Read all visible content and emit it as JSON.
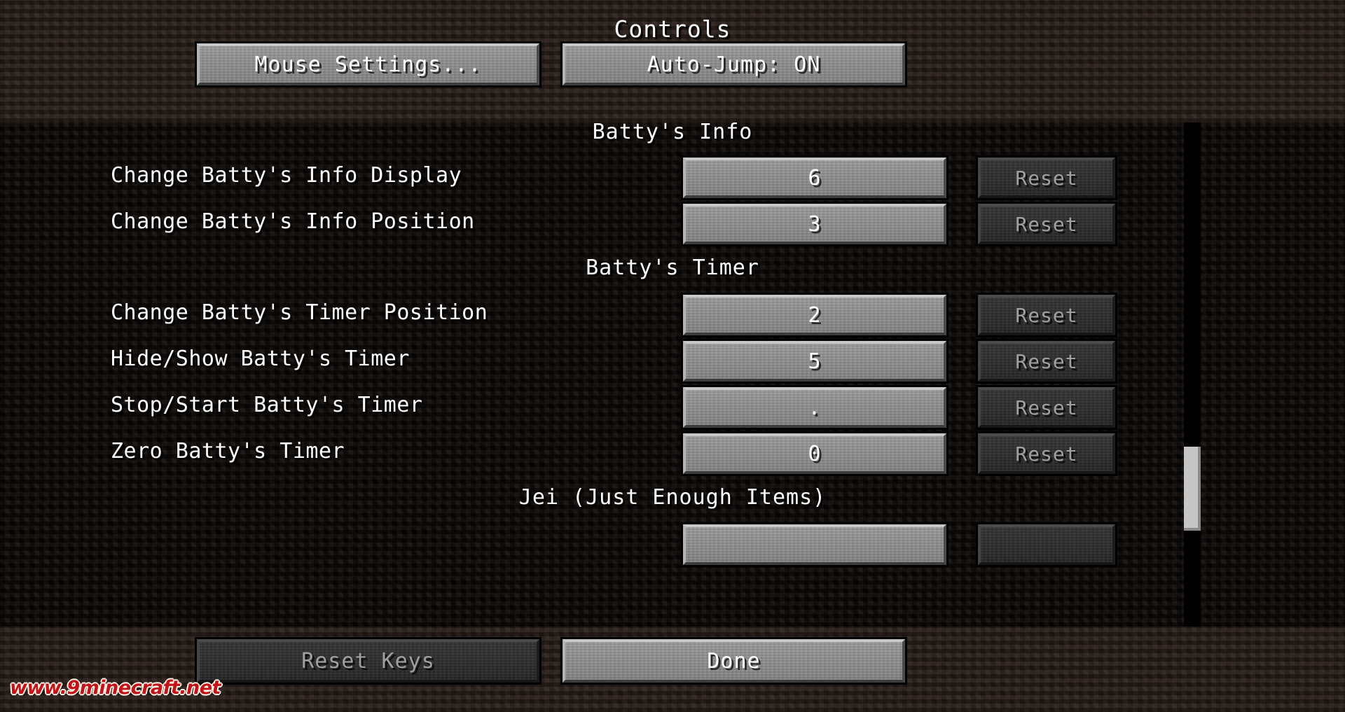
{
  "header": {
    "title": "Controls",
    "buttons": [
      {
        "name": "mouse-settings",
        "label": "Mouse Settings...",
        "enabled": true
      },
      {
        "name": "auto-jump",
        "label": "Auto-Jump: ON",
        "enabled": true
      }
    ]
  },
  "list": {
    "sections": [
      {
        "title": "Batty's Info",
        "rows": [
          {
            "label": "Change Batty's Info Display",
            "key": "6",
            "reset_label": "Reset",
            "reset_enabled": false
          },
          {
            "label": "Change Batty's Info Position",
            "key": "3",
            "reset_label": "Reset",
            "reset_enabled": false
          }
        ]
      },
      {
        "title": "Batty's Timer",
        "rows": [
          {
            "label": "Change Batty's Timer Position",
            "key": "2",
            "reset_label": "Reset",
            "reset_enabled": false
          },
          {
            "label": "Hide/Show Batty's Timer",
            "key": "5",
            "reset_label": "Reset",
            "reset_enabled": false
          },
          {
            "label": "Stop/Start Batty's Timer",
            "key": ".",
            "reset_label": "Reset",
            "reset_enabled": false
          },
          {
            "label": "Zero Batty's Timer",
            "key": "0",
            "reset_label": "Reset",
            "reset_enabled": false
          }
        ]
      },
      {
        "title": "Jei (Just Enough Items)",
        "rows": []
      }
    ]
  },
  "scrollbar": {
    "name": "vertical-scrollbar"
  },
  "footer": {
    "buttons": [
      {
        "name": "reset-keys",
        "label": "Reset Keys",
        "enabled": false
      },
      {
        "name": "done",
        "label": "Done",
        "enabled": true
      }
    ]
  },
  "watermark": {
    "text": "www.9minecraft.net"
  },
  "colors": {
    "button_face": "#8b8b8b",
    "button_disabled_face": "#2e2e2e",
    "text": "#ffffff",
    "text_disabled": "#a0a0a0",
    "watermark": "#c4121a",
    "dirt_light": "#342822",
    "dirt_dark": "#0f0b09"
  }
}
